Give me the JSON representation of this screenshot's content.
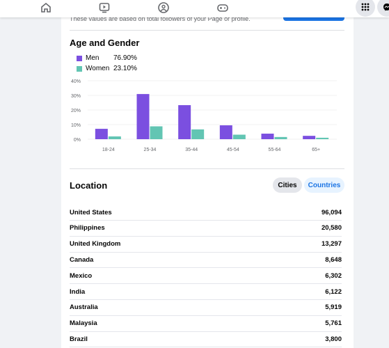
{
  "nav": {
    "icons": [
      "home-icon",
      "video-icon",
      "groups-icon",
      "gaming-icon",
      "menu-grid-icon",
      "messenger-icon"
    ]
  },
  "note": "These values are based on total followers of your Page or profile.",
  "age_gender": {
    "title": "Age and Gender",
    "legend": [
      {
        "label": "Men",
        "value": "76.90%",
        "color": "#7b4fe0"
      },
      {
        "label": "Women",
        "value": "23.10%",
        "color": "#62c5b3"
      }
    ]
  },
  "chart_data": {
    "type": "bar",
    "categories": [
      "18-24",
      "25-34",
      "35-44",
      "45-54",
      "55-64",
      "65+"
    ],
    "series": [
      {
        "name": "Men",
        "values": [
          7.1,
          30.9,
          23.3,
          9.5,
          3.8,
          2.3
        ]
      },
      {
        "name": "Women",
        "values": [
          1.9,
          8.8,
          6.7,
          3.1,
          1.5,
          1.0
        ]
      }
    ],
    "yticks": [
      "0%",
      "10%",
      "20%",
      "30%",
      "40%"
    ],
    "ylim": [
      0,
      40
    ],
    "grid": true
  },
  "location": {
    "title": "Location",
    "tabs": [
      {
        "label": "Cities",
        "active": true
      },
      {
        "label": "Countries",
        "active": false
      }
    ],
    "rows": [
      [
        "United States",
        "96,094"
      ],
      [
        "Philippines",
        "20,580"
      ],
      [
        "United Kingdom",
        "13,297"
      ],
      [
        "Canada",
        "8,648"
      ],
      [
        "Mexico",
        "6,302"
      ],
      [
        "India",
        "6,122"
      ],
      [
        "Australia",
        "5,919"
      ],
      [
        "Malaysia",
        "5,761"
      ],
      [
        "Brazil",
        "3,800"
      ]
    ]
  }
}
